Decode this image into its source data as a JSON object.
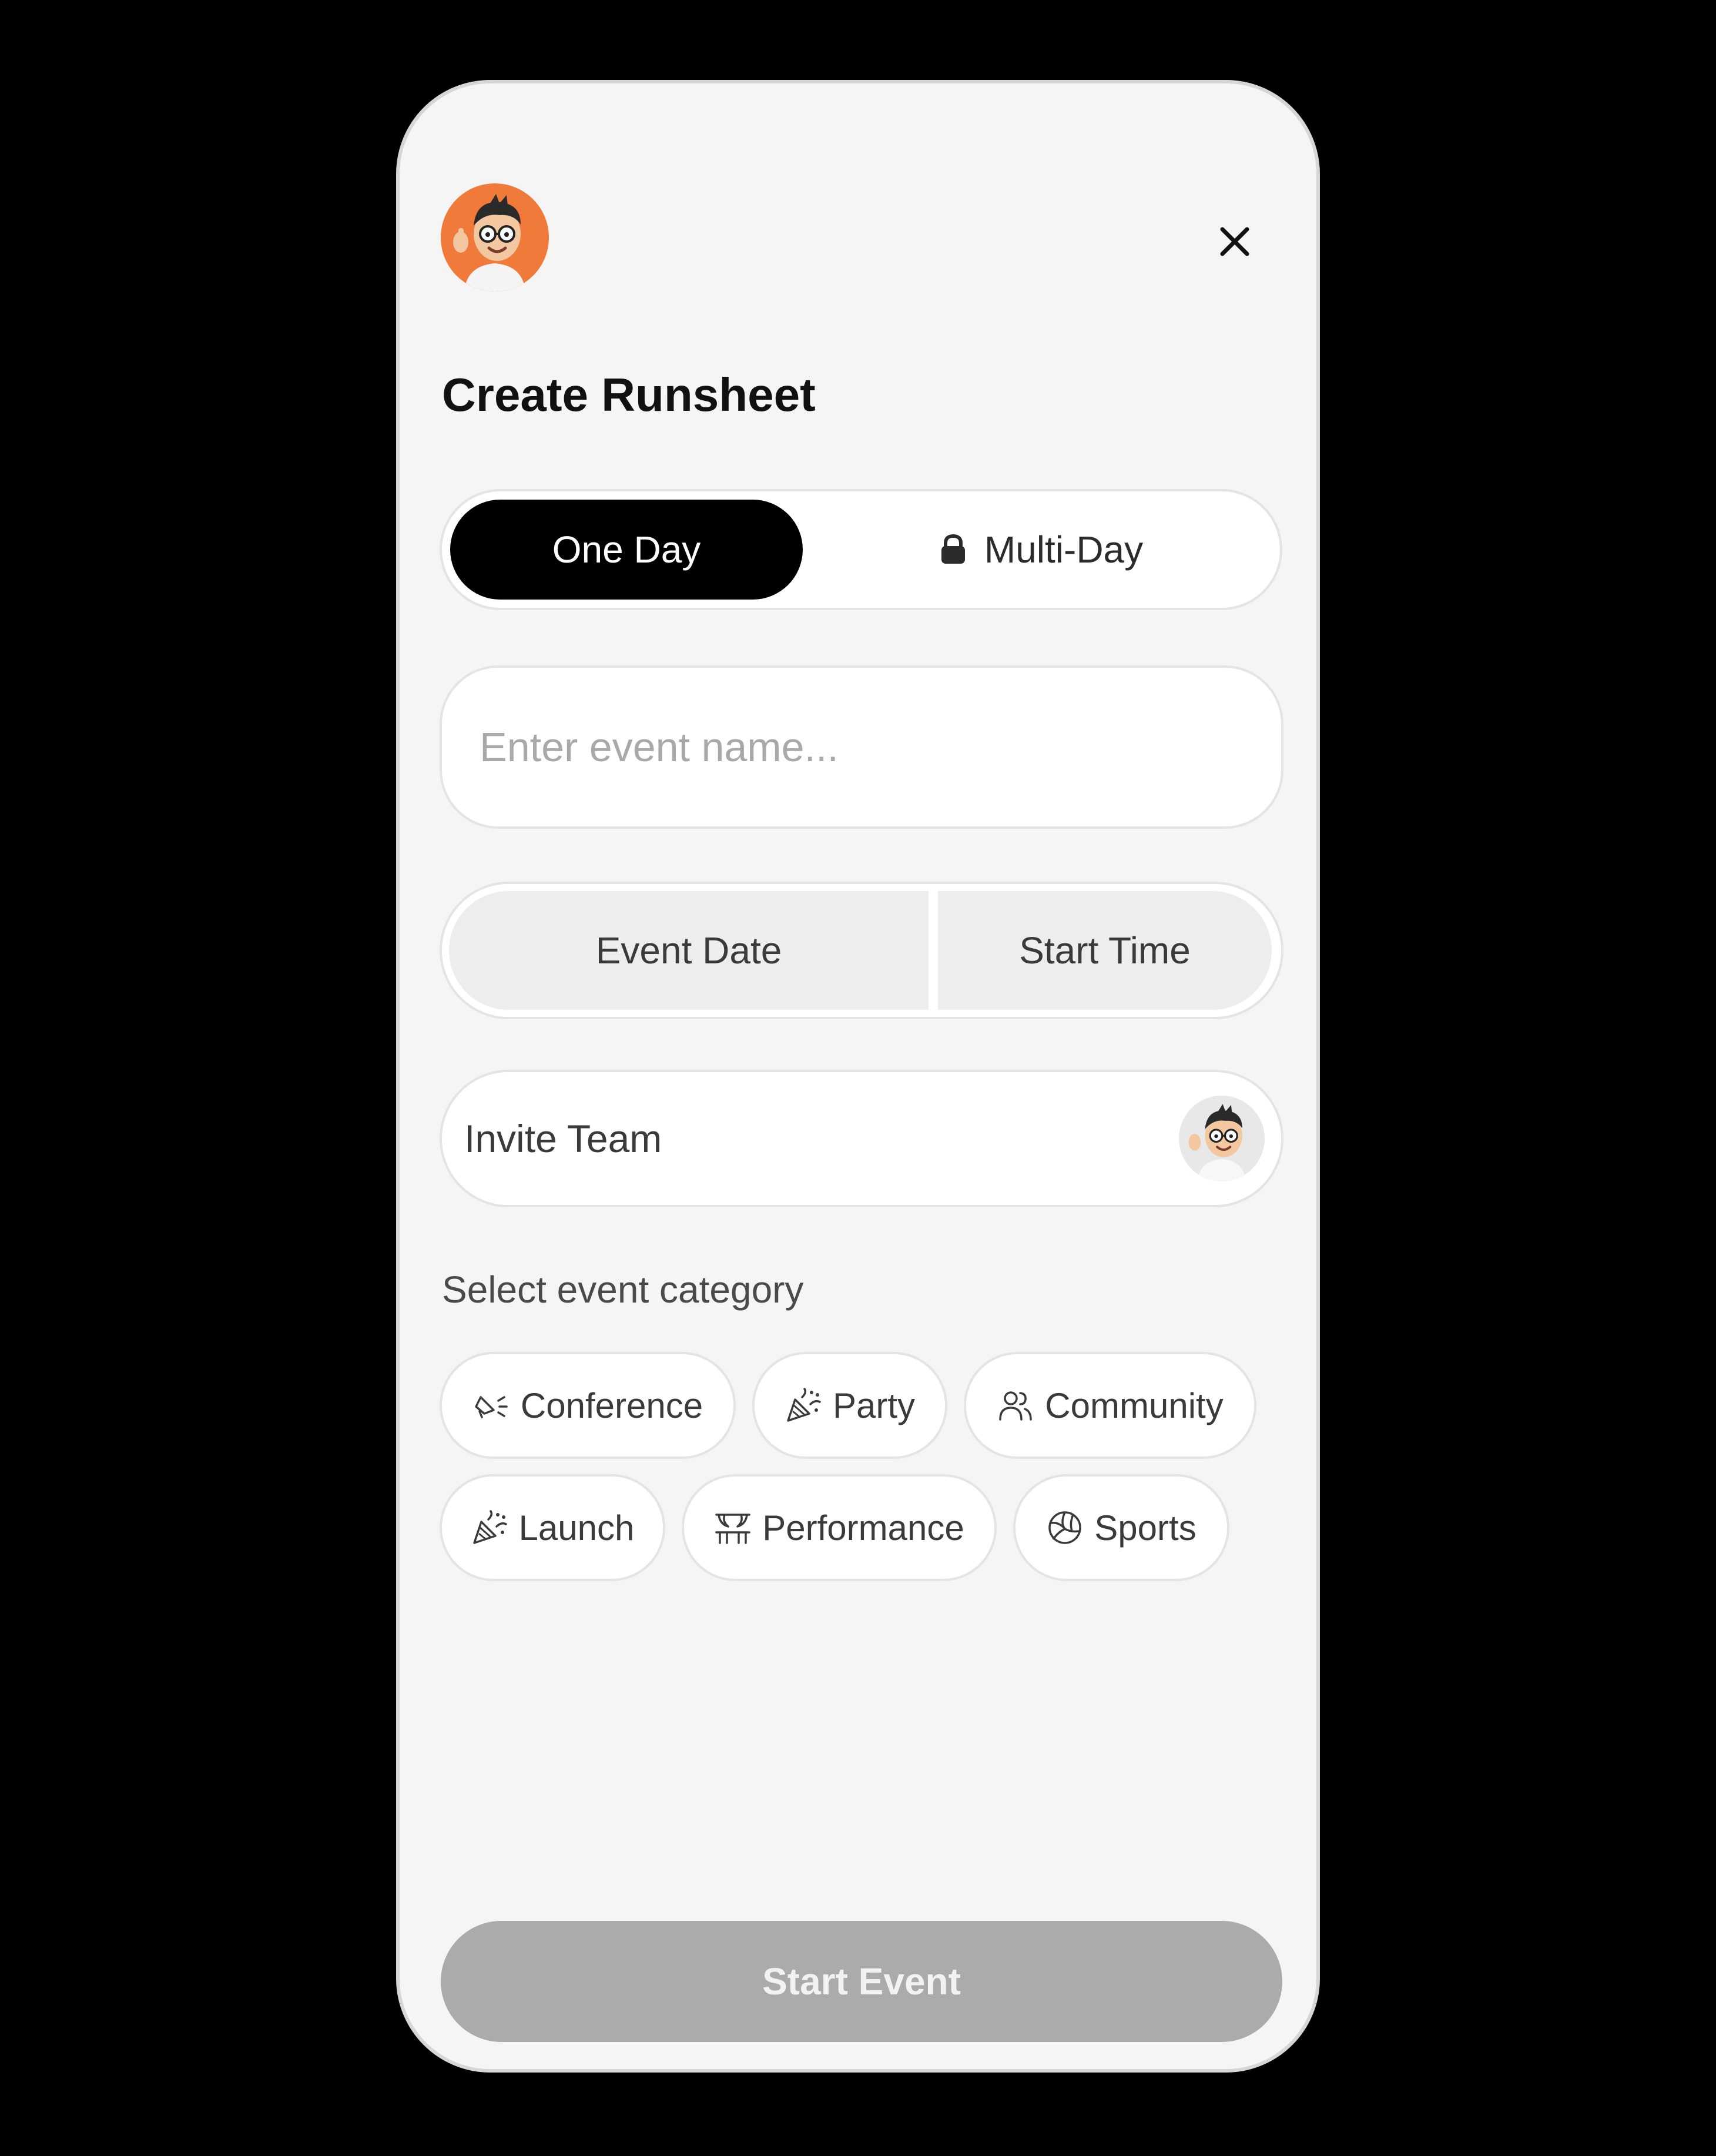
{
  "header": {
    "title": "Create Runsheet"
  },
  "mode_toggle": {
    "one_day": "One Day",
    "multi_day": "Multi-Day"
  },
  "event_name": {
    "placeholder": "Enter event name..."
  },
  "schedule": {
    "event_date": "Event Date",
    "start_time": "Start Time"
  },
  "invite": {
    "label": "Invite Team"
  },
  "category": {
    "label": "Select event category",
    "options": [
      "Conference",
      "Party",
      "Community",
      "Launch",
      "Performance",
      "Sports"
    ]
  },
  "actions": {
    "start_event": "Start Event"
  },
  "icons": {
    "close": "close-icon",
    "lock": "lock-icon",
    "conference": "megaphone-icon",
    "party": "party-popper-icon",
    "community": "users-icon",
    "launch": "confetti-icon",
    "performance": "stage-curtain-icon",
    "sports": "volleyball-icon"
  },
  "colors": {
    "background": "#000000",
    "card": "#f5f5f5",
    "active_segment": "#000000",
    "avatar_bg": "#f07a3a",
    "disabled_button": "#ababab"
  }
}
